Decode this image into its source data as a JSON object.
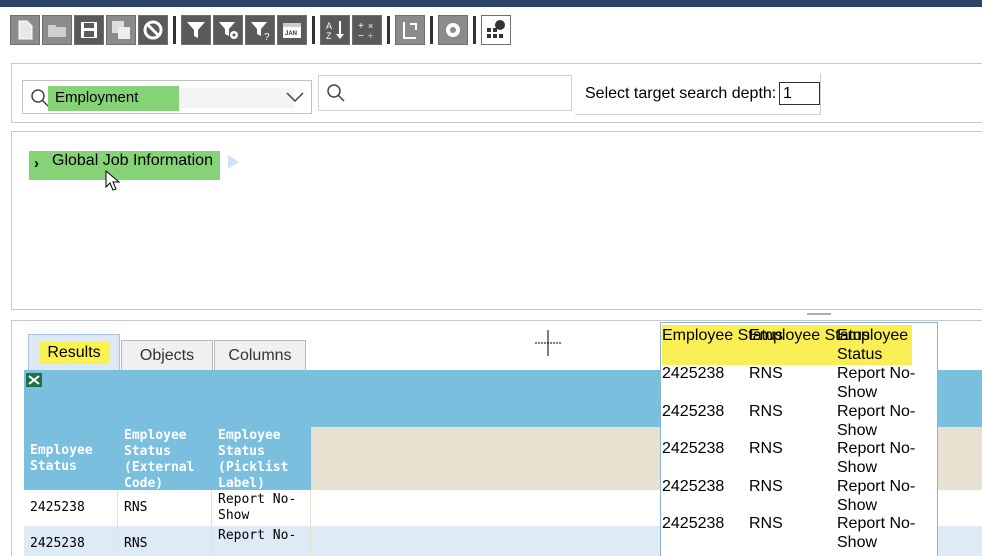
{
  "toolbar": {
    "buttons": [
      "new-document-icon",
      "open-folder-icon",
      "save-icon",
      "save-all-icon",
      "cancel-icon",
      "filter-icon",
      "filter-settings-icon",
      "filter-help-icon",
      "date-filter-icon",
      "sort-az-icon",
      "calculate-icon",
      "refresh-icon",
      "settings-icon",
      "schedule-icon"
    ],
    "date_icon_text": "JAN"
  },
  "search": {
    "entity_value": "Employment",
    "search_placeholder": "",
    "depth_label": "Select target search depth:",
    "depth_value": "1"
  },
  "tree": {
    "node_arrow": "›",
    "node_label": "Global Job Information"
  },
  "tabs": [
    "Results",
    "Objects",
    "Columns"
  ],
  "grid": {
    "headers": [
      "Employee Status",
      "Employee Status (External Code)",
      "Employee Status (Picklist Label)"
    ],
    "rows": [
      [
        "2425238",
        "RNS",
        "Report No-Show"
      ],
      [
        "2425238",
        "RNS",
        "Report No-"
      ]
    ]
  },
  "tooltip": {
    "headers": [
      "Employee Status",
      "Employee Status",
      "Employee Status"
    ],
    "rows": [
      [
        "2425238",
        "RNS",
        "Report No-Show"
      ],
      [
        "2425238",
        "RNS",
        "Report No-Show"
      ],
      [
        "2425238",
        "RNS",
        "Report No-Show"
      ],
      [
        "2425238",
        "RNS",
        "Report No-Show"
      ],
      [
        "2425238",
        "RNS",
        "Report No-Show"
      ]
    ]
  },
  "colors": {
    "highlight_green": "#86d277",
    "highlight_yellow": "#f9f250",
    "grid_header_blue": "#7bbfdf",
    "top_bar": "#2b4466"
  }
}
